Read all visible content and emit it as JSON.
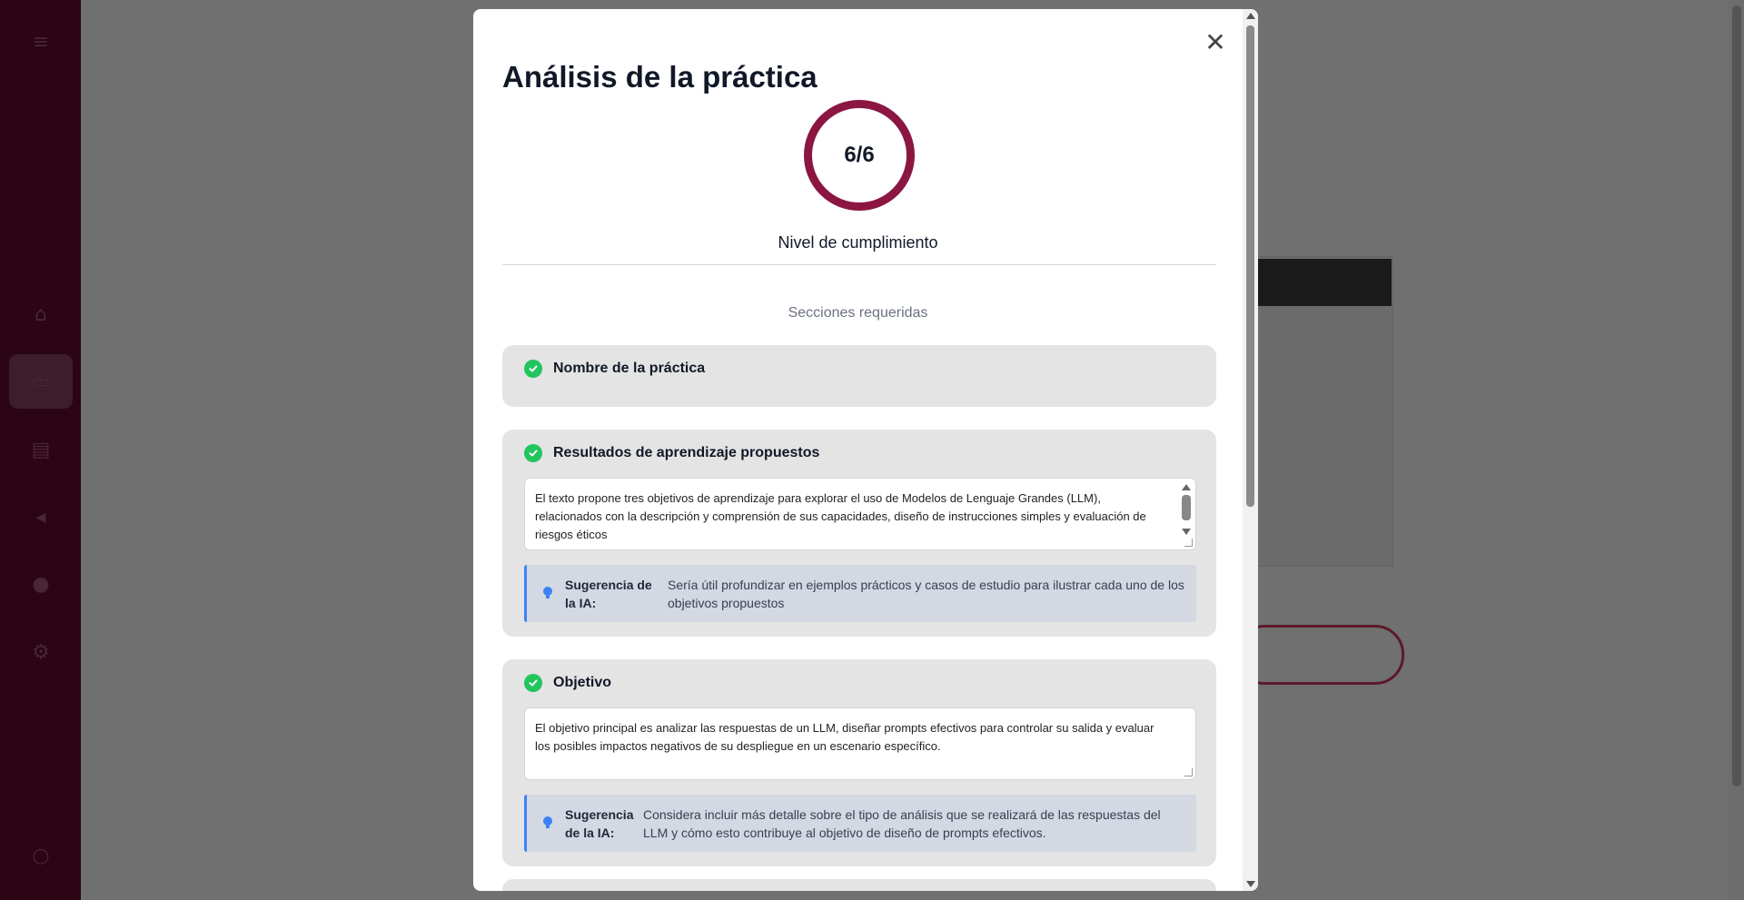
{
  "modal": {
    "title": "Análisis de la práctica",
    "score": "6/6",
    "score_label": "Nivel de cumplimiento",
    "sections_title": "Secciones requeridas",
    "close_symbol": "✕"
  },
  "sections": [
    {
      "title": "Nombre de la práctica",
      "status": "complete"
    },
    {
      "title": "Resultados de aprendizaje propuestos",
      "status": "complete",
      "content": "El texto propone tres objetivos de aprendizaje para explorar el uso de Modelos de Lenguaje Grandes (LLM), relacionados con la descripción y comprensión de sus capacidades, diseño de instrucciones simples y evaluación de riesgos éticos",
      "suggestion_label": "Sugerencia de la IA:",
      "suggestion": "Sería útil profundizar en ejemplos prácticos y casos de estudio para ilustrar cada uno de los objetivos propuestos"
    },
    {
      "title": "Objetivo",
      "status": "complete",
      "content": "El objetivo principal es analizar las respuestas de un LLM, diseñar prompts efectivos para controlar su salida y evaluar los posibles impactos negativos de su despliegue en un escenario específico.",
      "suggestion_label": "Sugerencia de la IA:",
      "suggestion": "Considera incluir más detalle sobre el tipo de análisis que se realizará de las respuestas del LLM y cómo esto contribuye al objetivo de diseño de prompts efectivos."
    }
  ],
  "colors": {
    "accent": "#8b1642",
    "check": "#22c55e",
    "suggestion_border": "#3b82f6",
    "sidebar": "#2b0514"
  },
  "icons": [
    "close-icon",
    "check-circle-icon",
    "lightbulb-icon"
  ]
}
